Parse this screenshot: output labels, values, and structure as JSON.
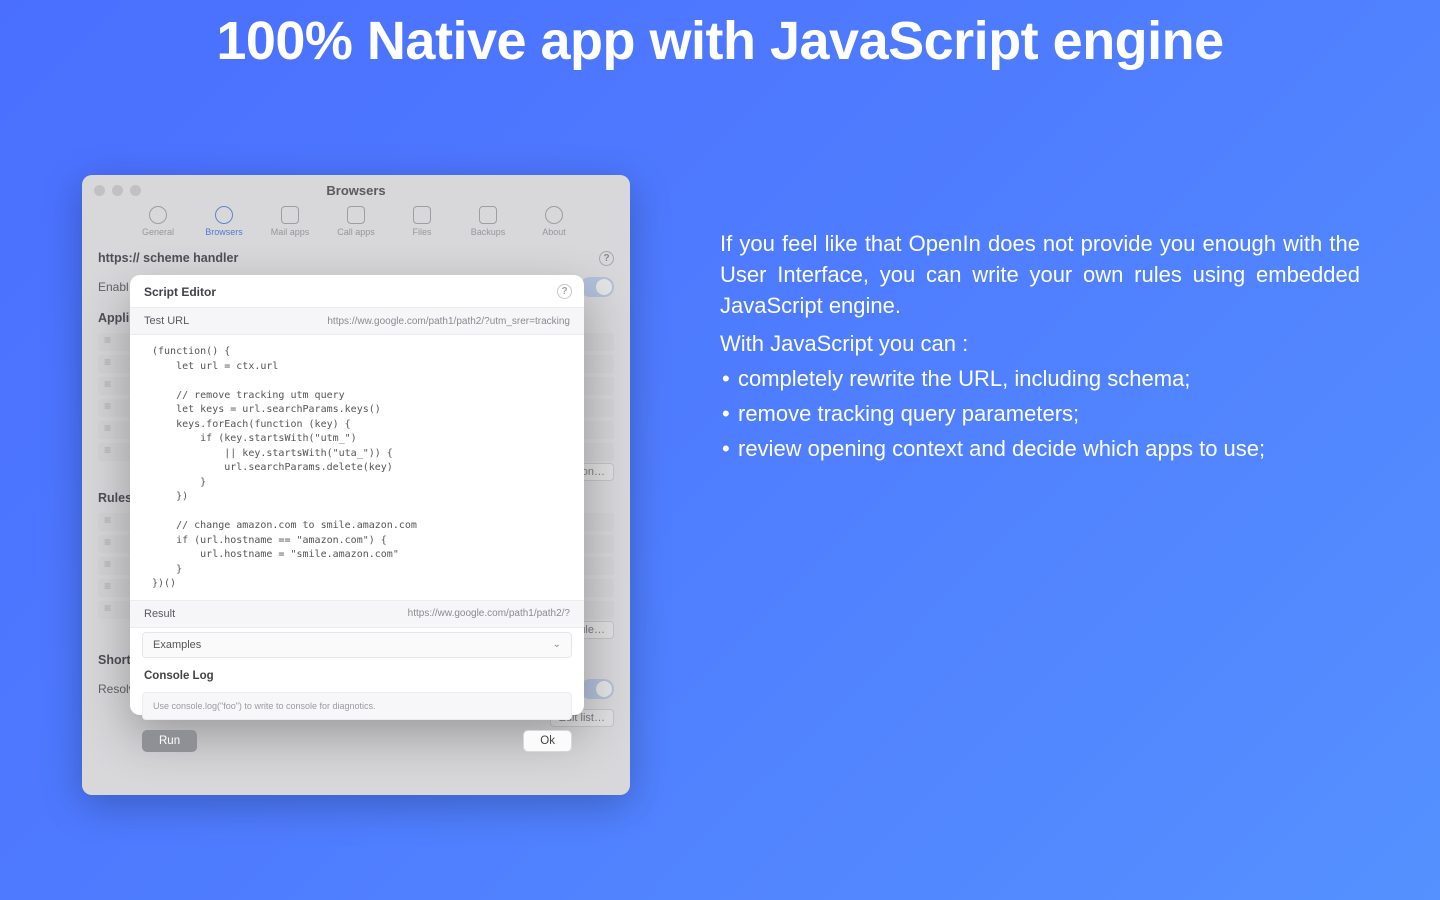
{
  "hero": {
    "title": "100% Native app with JavaScript engine"
  },
  "copy": {
    "paragraph": "If you feel like that OpenIn does not provide you enough with the User Interface, you can write your own rules using embedded JavaScript engine.",
    "lead": "With JavaScript you can :",
    "bullets": [
      "completely rewrite the URL, including schema;",
      "remove tracking query parameters;",
      "review opening context and decide which apps to use;"
    ]
  },
  "window": {
    "title": "Browsers",
    "tabs": [
      "General",
      "Browsers",
      "Mail apps",
      "Call apps",
      "Files",
      "Backups",
      "About"
    ],
    "active_tab_index": 1,
    "section_scheme": "https:// scheme handler",
    "enabled_label": "Enabl",
    "applications_label": "Appli",
    "action_button": "tion…",
    "rules_label": "Rules",
    "rule_button": "rule…",
    "shortened_label": "Shortened URLs",
    "resolve_label": "Resolve Shortened URLs",
    "edit_list_button": "Edit list…",
    "help_glyph": "?"
  },
  "sheet": {
    "title": "Script Editor",
    "help_glyph": "?",
    "test_url_label": "Test URL",
    "test_url_value": "https://ww.google.com/path1/path2/?utm_srer=tracking",
    "code": "(function() {\n    let url = ctx.url\n\n    // remove tracking utm query\n    let keys = url.searchParams.keys()\n    keys.forEach(function (key) {\n        if (key.startsWith(\"utm_\")\n            || key.startsWith(\"uta_\")) {\n            url.searchParams.delete(key)\n        }\n    })\n\n    // change amazon.com to smile.amazon.com\n    if (url.hostname == \"amazon.com\") {\n        url.hostname = \"smile.amazon.com\"\n    }\n})()",
    "result_label": "Result",
    "result_value": "https://ww.google.com/path1/path2/?",
    "examples_label": "Examples",
    "console_label": "Console Log",
    "console_hint": "Use console.log(\"foo\") to write to console for diagnotics.",
    "run_label": "Run",
    "ok_label": "Ok"
  }
}
